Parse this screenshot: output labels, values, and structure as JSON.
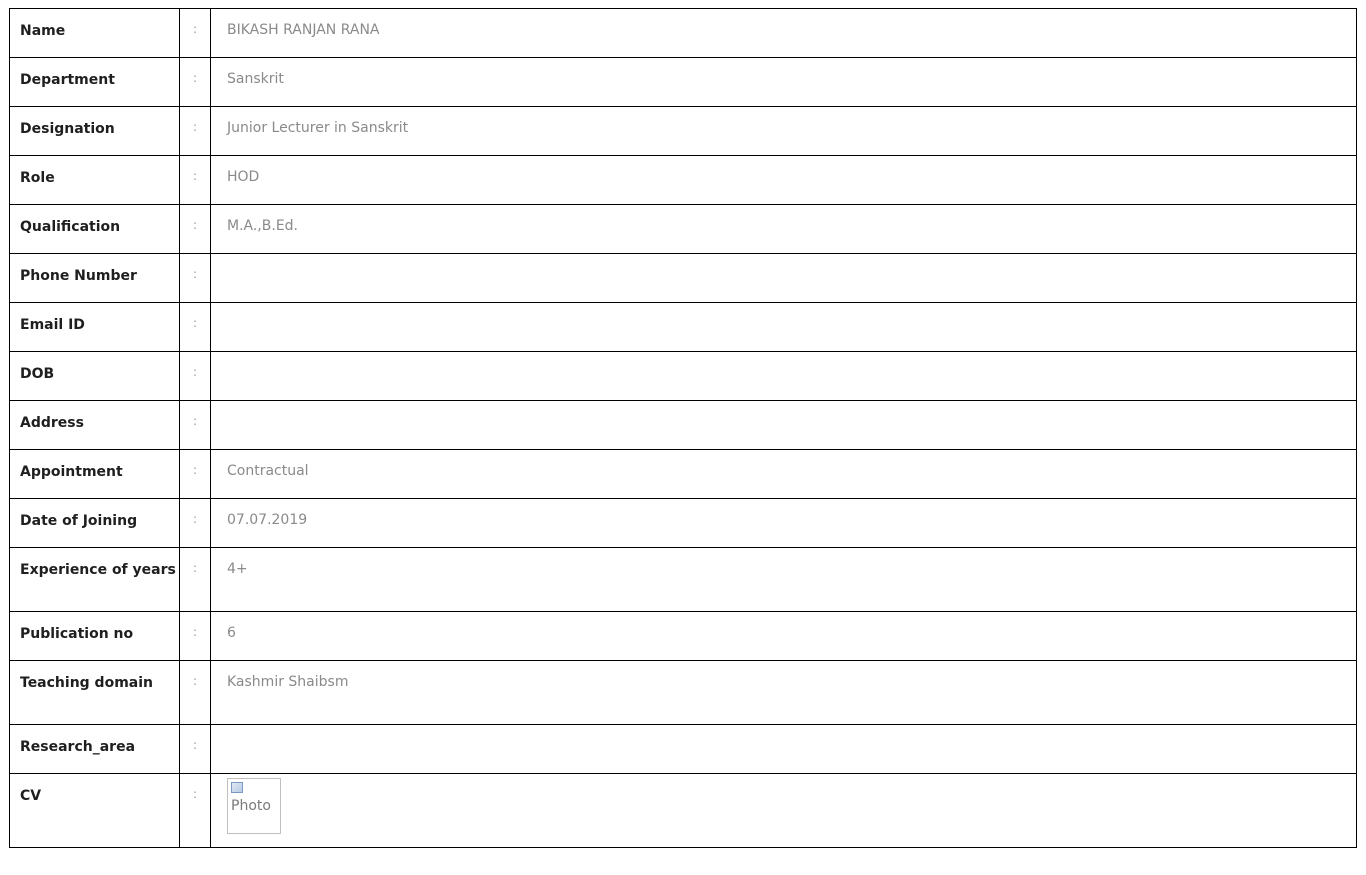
{
  "rows": [
    {
      "label": "Name",
      "sep": ":",
      "value": "BIKASH RANJAN RANA"
    },
    {
      "label": "Department",
      "sep": ":",
      "value": "Sanskrit"
    },
    {
      "label": "Designation",
      "sep": ":",
      "value": "Junior Lecturer in Sanskrit"
    },
    {
      "label": "Role",
      "sep": ":",
      "value": "HOD"
    },
    {
      "label": "Qualification",
      "sep": ":",
      "value": "M.A.,B.Ed."
    },
    {
      "label": "Phone Number",
      "sep": ":",
      "value": ""
    },
    {
      "label": "Email ID",
      "sep": ":",
      "value": ""
    },
    {
      "label": "DOB",
      "sep": ":",
      "value": ""
    },
    {
      "label": "Address",
      "sep": ":",
      "value": ""
    },
    {
      "label": "Appointment",
      "sep": ":",
      "value": "Contractual"
    },
    {
      "label": "Date of Joining",
      "sep": ":",
      "value": "07.07.2019"
    },
    {
      "label": "Experience of years",
      "sep": ":",
      "value": "4+"
    },
    {
      "label": "Publication no",
      "sep": ":",
      "value": "6"
    },
    {
      "label": "Teaching domain",
      "sep": ":",
      "value": "Kashmir Shaibsm"
    },
    {
      "label": "Research_area",
      "sep": ":",
      "value": ""
    },
    {
      "label": "CV",
      "sep": ":",
      "value": ""
    }
  ],
  "cv": {
    "image_alt": "Photo",
    "icon": "broken-image-icon"
  }
}
